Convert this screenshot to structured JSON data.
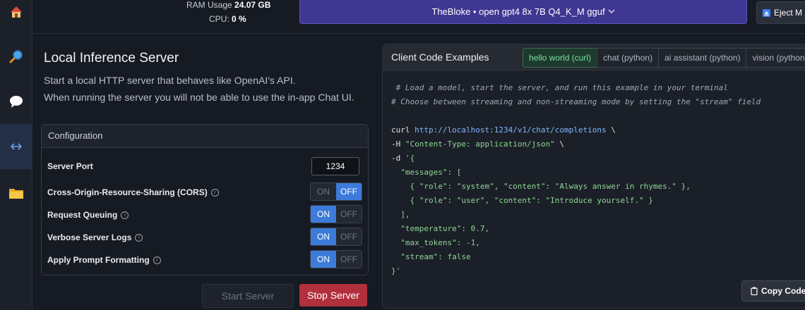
{
  "topbar": {
    "ram_label": "RAM Usage",
    "ram_value": "24.07 GB",
    "cpu_label": "CPU:",
    "cpu_value": "0 %",
    "model_name": "TheBloke • open gpt4 8x 7B Q4_K_M gguf",
    "eject_label": "Eject M"
  },
  "sidebar": {
    "items": [
      {
        "name": "home",
        "icon": "home-icon"
      },
      {
        "name": "search",
        "icon": "search-icon"
      },
      {
        "name": "chat",
        "icon": "chat-icon"
      },
      {
        "name": "server",
        "icon": "arrows-icon",
        "active": true
      },
      {
        "name": "models",
        "icon": "folder-icon"
      }
    ]
  },
  "server": {
    "title": "Local Inference Server",
    "desc_line1": "Start a local HTTP server that behaves like OpenAI's API.",
    "desc_line2": "When running the server you will not be able to use the in-app Chat UI.",
    "config_title": "Configuration",
    "port_label": "Server Port",
    "port_value": "1234",
    "cors_label": "Cross-Origin-Resource-Sharing (CORS)",
    "cors_state": "OFF",
    "queue_label": "Request Queuing",
    "queue_state": "ON",
    "verbose_label": "Verbose Server Logs",
    "verbose_state": "ON",
    "prompt_label": "Apply Prompt Formatting",
    "prompt_state": "ON",
    "on_label": "ON",
    "off_label": "OFF",
    "start_label": "Start Server",
    "stop_label": "Stop Server"
  },
  "client": {
    "title": "Client Code Examples",
    "tabs": [
      "hello world (curl)",
      "chat (python)",
      "ai assistant (python)",
      "vision (python"
    ],
    "active_tab": 0,
    "copy_label": "Copy Code",
    "code": {
      "c1": " # Load a model, start the server, and run this example in your terminal",
      "c2": "# Choose between streaming and non-streaming mode by setting the \"stream\" field",
      "curl": "curl ",
      "url": "http://localhost:1234/v1/chat/completions",
      "bs": " \\",
      "h_flag": "-H ",
      "h_val": "\"Content-Type: application/json\"",
      "d_flag": "-d ",
      "d_open": "'{",
      "messages_key": "  \"messages\": [",
      "m1": "    { \"role\": \"system\", \"content\": \"Always answer in rhymes.\" },",
      "m2": "    { \"role\": \"user\", \"content\": \"Introduce yourself.\" }",
      "close_arr": "  ],",
      "temp": "  \"temperature\": 0.7,",
      "max": "  \"max_tokens\": -1,",
      "stream": "  \"stream\": false",
      "d_close": "}'"
    }
  },
  "colors": {
    "accent_blue": "#3c7bd9",
    "model_purple": "#3f3791",
    "stop_red": "#b22f3c",
    "tab_green": "#7be09b"
  }
}
